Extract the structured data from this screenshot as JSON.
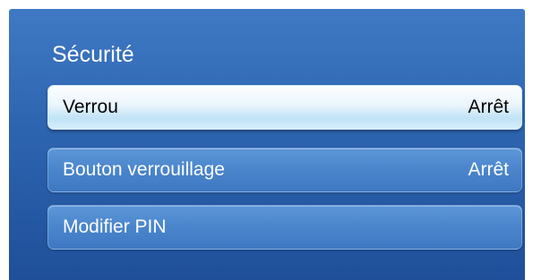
{
  "colors": {
    "panel_background": "#2d64b0",
    "item_background": "#4a85cc",
    "selected_item_background": "#eaf5fd",
    "text_light": "#ffffff",
    "text_dark": "#000000"
  },
  "panel": {
    "title": "Sécurité"
  },
  "menu": {
    "items": [
      {
        "label": "Verrou",
        "value": "Arrêt",
        "selected": true
      },
      {
        "label": "Bouton verrouillage",
        "value": "Arrêt",
        "selected": false
      },
      {
        "label": "Modifier PIN",
        "value": "",
        "selected": false
      }
    ]
  }
}
